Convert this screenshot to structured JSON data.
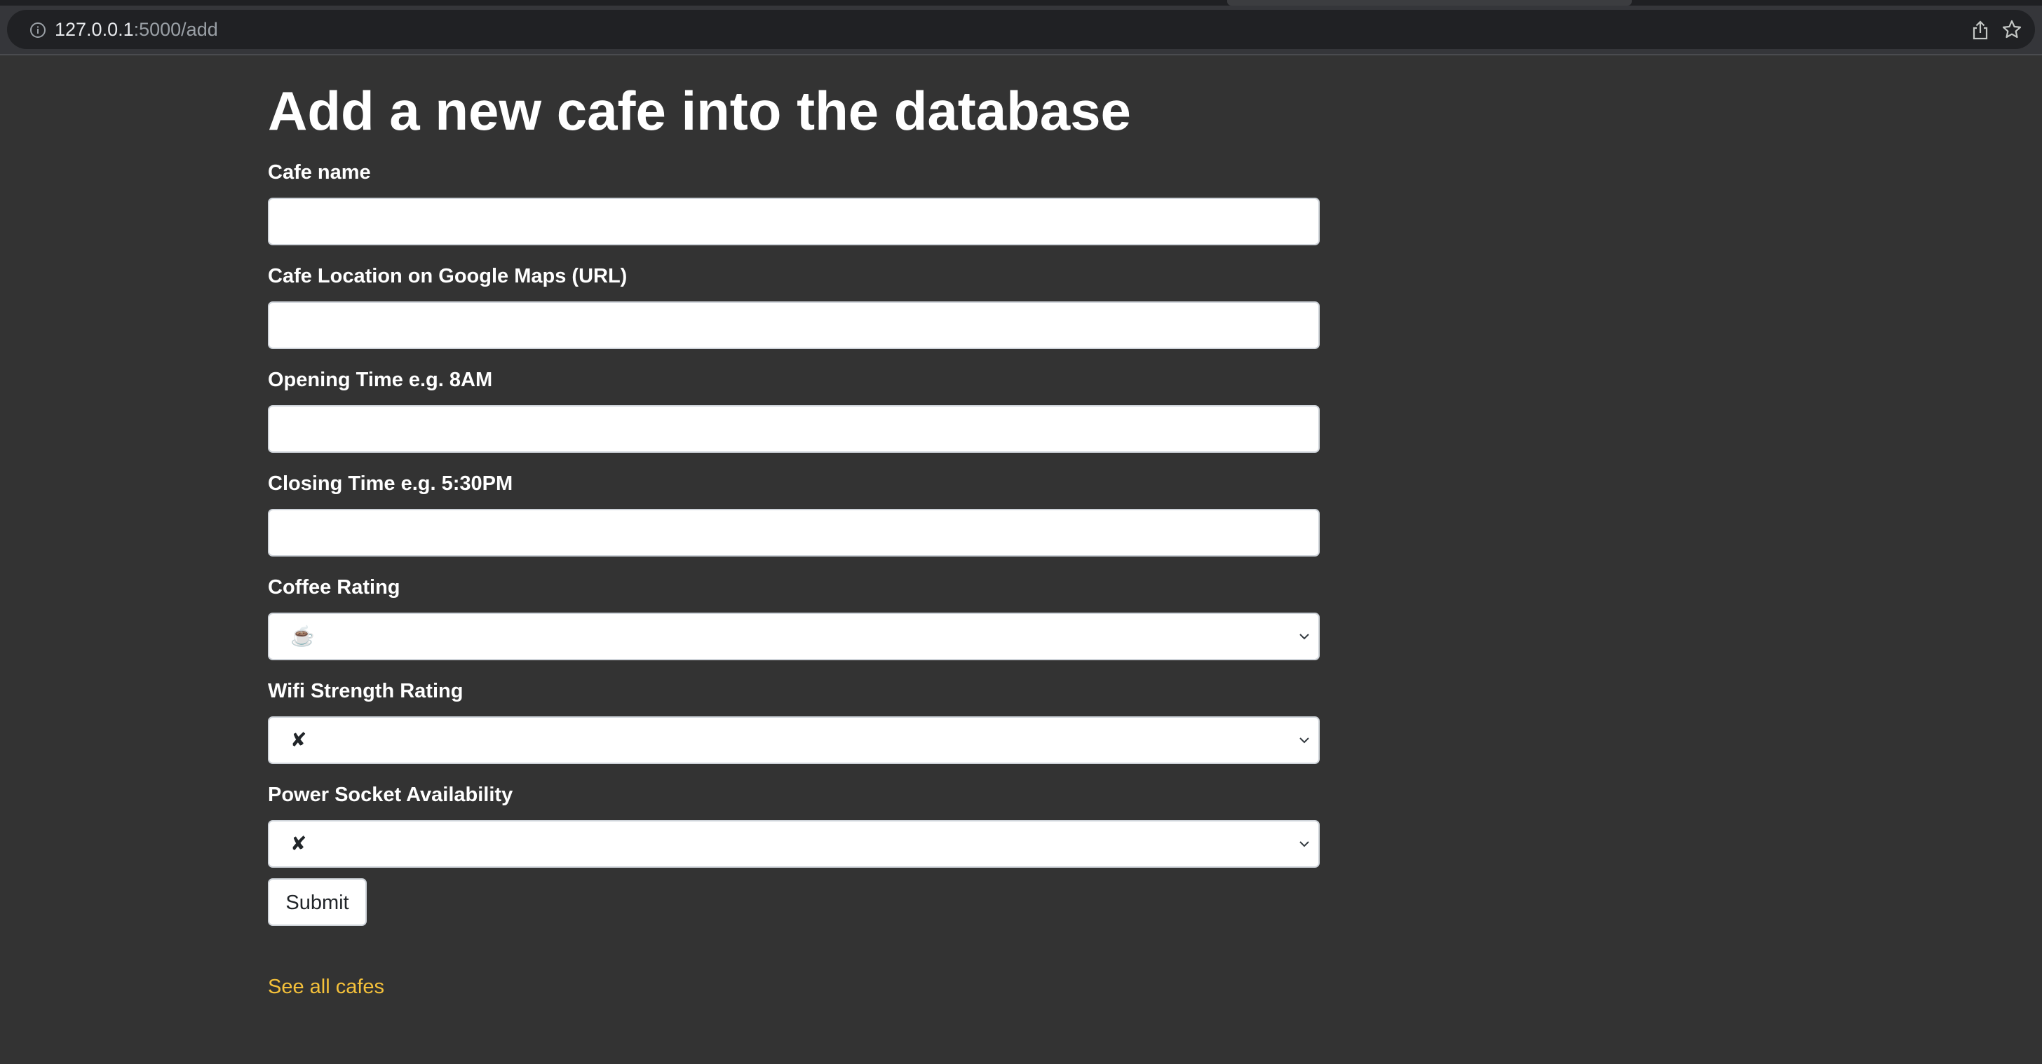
{
  "browser": {
    "url_host": "127.0.0.1",
    "url_rest": ":5000/add"
  },
  "page": {
    "title": "Add a new cafe into the database"
  },
  "form": {
    "fields": [
      {
        "label": "Cafe name",
        "type": "text",
        "value": ""
      },
      {
        "label": "Cafe Location on Google Maps (URL)",
        "type": "text",
        "value": ""
      },
      {
        "label": "Opening Time e.g. 8AM",
        "type": "text",
        "value": ""
      },
      {
        "label": "Closing Time e.g. 5:30PM",
        "type": "text",
        "value": ""
      },
      {
        "label": "Coffee Rating",
        "type": "select",
        "value": "☕️"
      },
      {
        "label": "Wifi Strength Rating",
        "type": "select",
        "value": "✘"
      },
      {
        "label": "Power Socket Availability",
        "type": "select",
        "value": "✘"
      }
    ],
    "submit_label": "Submit"
  },
  "links": {
    "see_all": "See all cafes"
  },
  "colors": {
    "background": "#333333",
    "link": "#f5c13a"
  }
}
